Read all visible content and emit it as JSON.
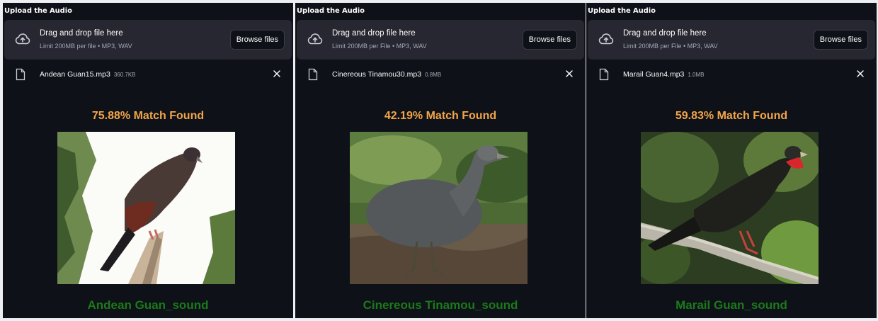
{
  "panels": [
    {
      "title": "Upload the Audio",
      "dropzone": {
        "title": "Drag and drop file here",
        "subtitle": "Limit 200MB per file • MP3, WAV",
        "button": "Browse files",
        "icon": "cloud-upload-icon"
      },
      "file": {
        "name": "Andean Guan15.mp3",
        "size": "360.7KB"
      },
      "match": "75.88% Match Found",
      "species": "Andean Guan_sound"
    },
    {
      "title": "Upload the Audio",
      "dropzone": {
        "title": "Drag and drop file here",
        "subtitle": "Limit 200MB per File • MP3, WAV",
        "button": "Browse files",
        "icon": "cloud-upload-icon"
      },
      "file": {
        "name": "Cinereous Tinamou30.mp3",
        "size": "0.8MB"
      },
      "match": "42.19% Match Found",
      "species": "Cinereous Tinamou_sound"
    },
    {
      "title": "Upload the Audio",
      "dropzone": {
        "title": "Drag and drop file here",
        "subtitle": "Limit 200MB per File • MP3, WAV",
        "button": "Browse files",
        "icon": "cloud-upload-icon"
      },
      "file": {
        "name": "Marail Guan4.mp3",
        "size": "1.0MB"
      },
      "match": "59.83% Match Found",
      "species": "Marail Guan_sound"
    }
  ],
  "colors": {
    "app_background": "#0e1117",
    "dropzone_background": "#262730",
    "match_text": "#f2a54a",
    "species_text": "#1a7a1a"
  }
}
